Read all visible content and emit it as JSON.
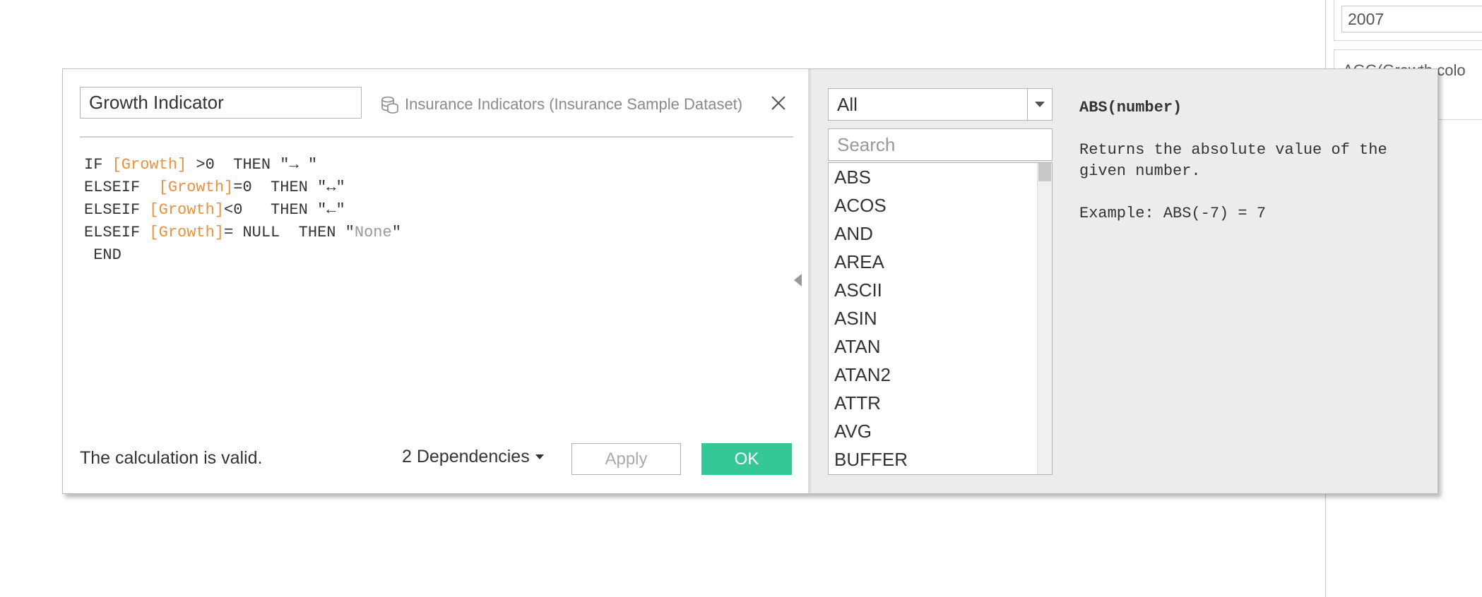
{
  "background": {
    "filter_value": "2007",
    "card_text": "AGG(Growth colo"
  },
  "dialog": {
    "calc_name": "Growth Indicator",
    "datasource": "Insurance Indicators (Insurance Sample Dataset)",
    "formula": {
      "line1": {
        "k1": "IF ",
        "f1": "[Growth]",
        "rest": " >0  THEN \"→ \""
      },
      "line2": {
        "k1": "ELSEIF  ",
        "f1": "[Growth]",
        "rest": "=0  THEN \"↔\""
      },
      "line3": {
        "k1": "ELSEIF ",
        "f1": "[Growth]",
        "rest": "<0   THEN \"←\""
      },
      "line4": {
        "k1": "ELSEIF ",
        "f1": "[Growth]",
        "rest": "= NULL  THEN \"",
        "str": "None",
        "end": "\""
      },
      "line5": " END"
    },
    "status": "The calculation is valid.",
    "dependencies_label": "2 Dependencies",
    "apply_label": "Apply",
    "ok_label": "OK",
    "category_select": "All",
    "search_placeholder": "Search",
    "functions": [
      "ABS",
      "ACOS",
      "AND",
      "AREA",
      "ASCII",
      "ASIN",
      "ATAN",
      "ATAN2",
      "ATTR",
      "AVG",
      "BUFFER"
    ],
    "help": {
      "signature": "ABS(number)",
      "description": "Returns the absolute value of the given number.",
      "example": "Example: ABS(-7) = 7"
    }
  },
  "colors": {
    "accent": "#35c797",
    "field": "#e8913f"
  }
}
